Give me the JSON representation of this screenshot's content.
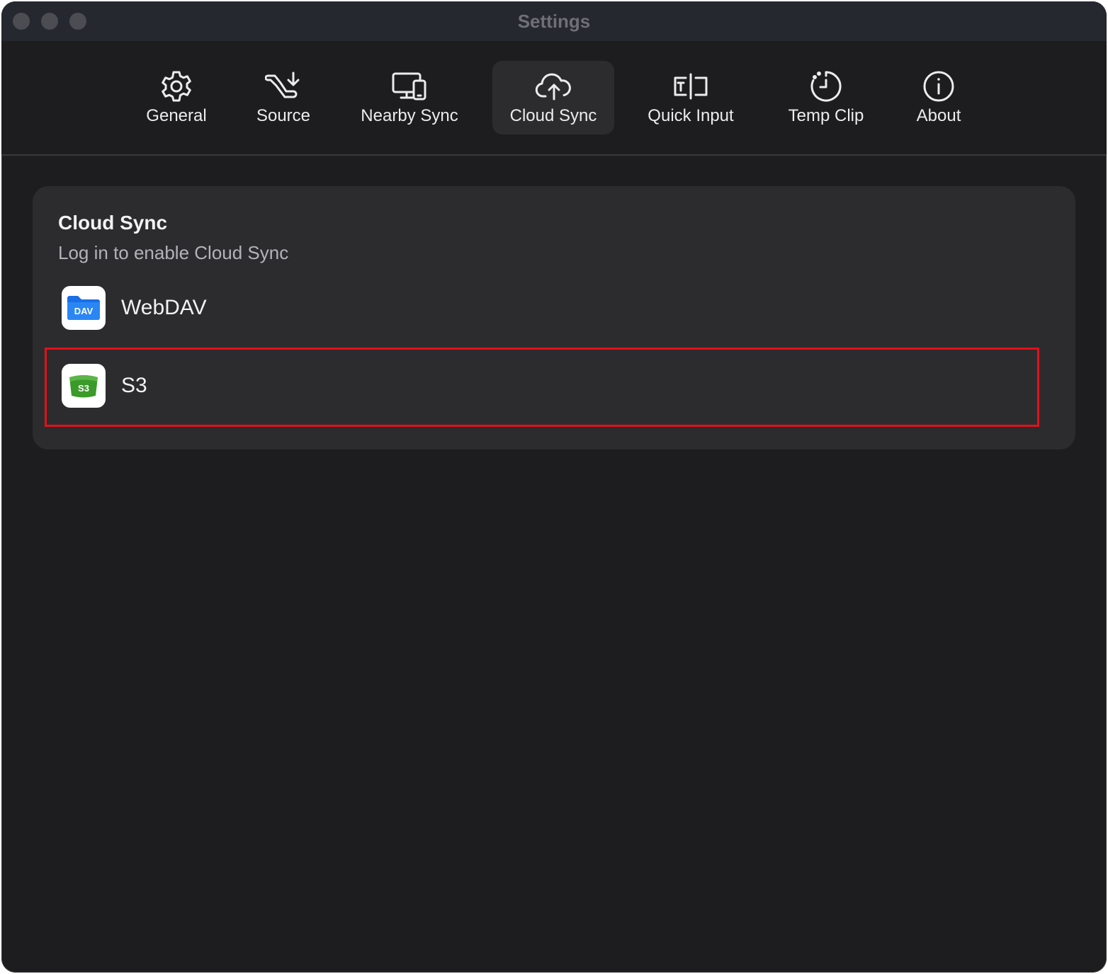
{
  "window": {
    "title": "Settings"
  },
  "tabs": [
    {
      "label": "General",
      "icon": "gear-icon",
      "active": false
    },
    {
      "label": "Source",
      "icon": "source-icon",
      "active": false
    },
    {
      "label": "Nearby Sync",
      "icon": "devices-icon",
      "active": false
    },
    {
      "label": "Cloud Sync",
      "icon": "cloud-upload-icon",
      "active": true
    },
    {
      "label": "Quick Input",
      "icon": "text-input-icon",
      "active": false
    },
    {
      "label": "Temp Clip",
      "icon": "timer-icon",
      "active": false
    },
    {
      "label": "About",
      "icon": "info-icon",
      "active": false
    }
  ],
  "cloud_sync": {
    "title": "Cloud Sync",
    "subtitle": "Log in to enable Cloud Sync",
    "providers": [
      {
        "label": "WebDAV",
        "icon": "webdav-icon",
        "icon_text": "DAV",
        "icon_color": "#1a6fe8"
      },
      {
        "label": "S3",
        "icon": "s3-icon",
        "icon_text": "S3",
        "icon_color": "#3a9a2a",
        "highlighted": true
      }
    ]
  },
  "colors": {
    "window_bg": "#1d1d1f",
    "card_bg": "#2c2c2e",
    "highlight": "#e3101a"
  }
}
